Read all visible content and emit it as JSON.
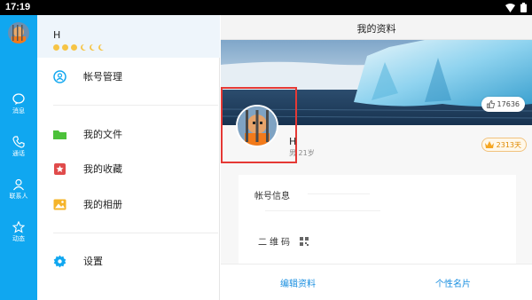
{
  "status_bar": {
    "time": "17:19"
  },
  "rail": {
    "items": [
      {
        "label": "消息",
        "icon": "message-icon"
      },
      {
        "label": "通话",
        "icon": "phone-icon"
      },
      {
        "label": "联系人",
        "icon": "contacts-icon"
      },
      {
        "label": "动态",
        "icon": "star-icon"
      }
    ]
  },
  "profile": {
    "name": "H"
  },
  "menu": {
    "account": "帐号管理",
    "files": "我的文件",
    "favorites": "我的收藏",
    "album": "我的相册",
    "settings": "设置"
  },
  "detail": {
    "title": "我的资料",
    "likes": "17636",
    "user_name": "H",
    "user_info": "男 21岁",
    "days": "2313天",
    "account_info": "帐号信息",
    "qr_code": "二维码",
    "edit_profile": "编辑资料",
    "card": "个性名片"
  },
  "colors": {
    "accent": "#10a7f0",
    "highlight": "#e53935",
    "link": "#1a8fe0"
  }
}
